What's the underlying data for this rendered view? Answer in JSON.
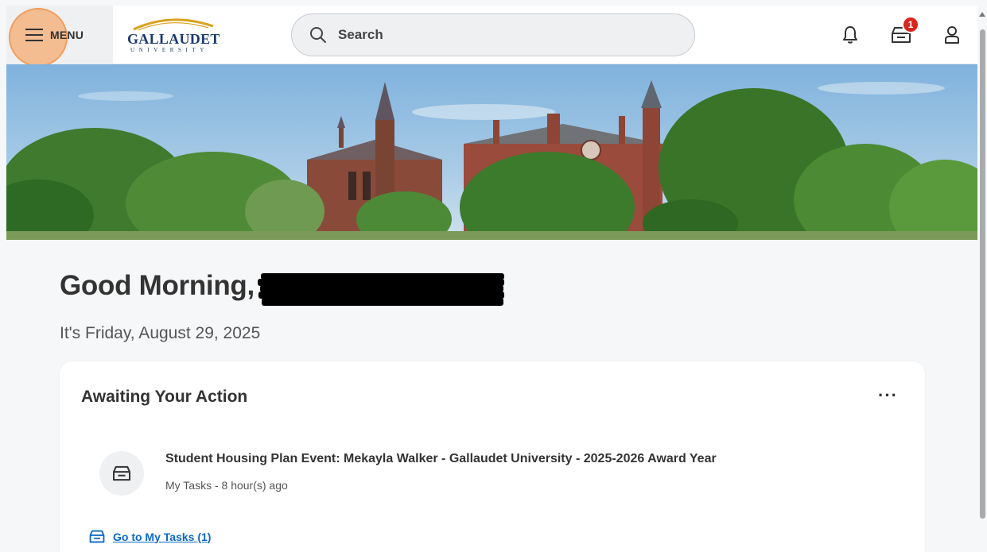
{
  "header": {
    "menu_label": "MENU",
    "logo_name": "GALLAUDET",
    "logo_subtitle": "UNIVERSITY",
    "search_placeholder": "Search",
    "inbox_badge_count": "1",
    "icons": [
      "hamburger-icon",
      "search-icon",
      "bell-icon",
      "inbox-icon",
      "user-icon"
    ]
  },
  "main": {
    "greeting": "Good Morning,",
    "date_text": "It's Friday, August 29, 2025"
  },
  "awaiting_card": {
    "title": "Awaiting Your Action",
    "more_label": "···",
    "tasks": [
      {
        "title": "Student Housing Plan Event: Mekayla Walker - Gallaudet University - 2025-2026 Award Year",
        "meta": "My Tasks - 8 hour(s) ago",
        "icon": "inbox-icon"
      }
    ],
    "go_link_label": "Go to My Tasks (1)"
  },
  "colors": {
    "accent_link": "#0b69c7",
    "badge": "#d9261c",
    "menu_highlight": "#f6a05c",
    "logo_navy": "#1a3a6e"
  }
}
